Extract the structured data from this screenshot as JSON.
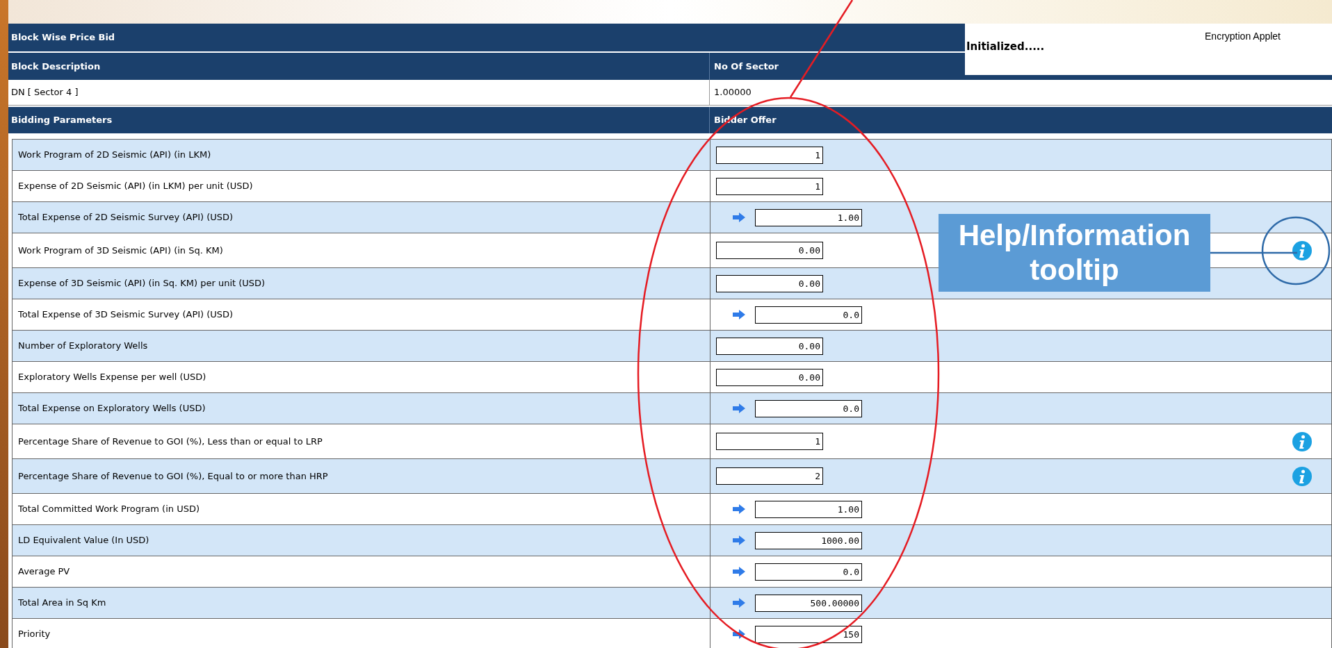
{
  "title": "Block Wise Price Bid",
  "applet": {
    "status": "Initialized.....",
    "name": "Encryption Applet"
  },
  "block_table": {
    "columns": [
      "Block Description",
      "No Of Sector"
    ],
    "row": [
      "DN [ Sector 4 ]",
      "1.00000"
    ]
  },
  "bid_table": {
    "columns": [
      "Bidding Parameters",
      "Bidder Offer"
    ],
    "rows": [
      {
        "label": "Work Program of 2D Seismic (API) (in LKM)",
        "value": "1",
        "computed": false,
        "info": false
      },
      {
        "label": "Expense of 2D Seismic (API) (in LKM) per unit (USD)",
        "value": "1",
        "computed": false,
        "info": false
      },
      {
        "label": "Total Expense of 2D Seismic Survey (API) (USD)",
        "value": "1.00",
        "computed": true,
        "info": false
      },
      {
        "label": "Work Program of 3D Seismic (API) (in Sq. KM)",
        "value": "0.00",
        "computed": false,
        "info": true
      },
      {
        "label": "Expense of 3D Seismic (API) (in Sq. KM) per unit (USD)",
        "value": "0.00",
        "computed": false,
        "info": false
      },
      {
        "label": "Total Expense of 3D Seismic Survey (API) (USD)",
        "value": "0.0",
        "computed": true,
        "info": false
      },
      {
        "label": "Number of Exploratory Wells",
        "value": "0.00",
        "computed": false,
        "info": false
      },
      {
        "label": "Exploratory Wells Expense per well (USD)",
        "value": "0.00",
        "computed": false,
        "info": false
      },
      {
        "label": "Total Expense on Exploratory Wells (USD)",
        "value": "0.0",
        "computed": true,
        "info": false
      },
      {
        "label": "Percentage Share of Revenue to GOI (%), Less than or equal to LRP",
        "value": "1",
        "computed": false,
        "info": true
      },
      {
        "label": "Percentage Share of Revenue to GOI (%), Equal to or more than HRP",
        "value": "2",
        "computed": false,
        "info": true
      },
      {
        "label": "Total Committed Work Program (in USD)",
        "value": "1.00",
        "computed": true,
        "info": false
      },
      {
        "label": "LD Equivalent Value (In USD)",
        "value": "1000.00",
        "computed": true,
        "info": false
      },
      {
        "label": "Average PV",
        "value": "0.0",
        "computed": true,
        "info": false
      },
      {
        "label": "Total Area in Sq Km",
        "value": "500.00000",
        "computed": true,
        "info": false
      },
      {
        "label": "Priority",
        "value": "150",
        "computed": true,
        "info": false
      }
    ]
  },
  "annotation": {
    "callout": "Help/Information tooltip"
  }
}
